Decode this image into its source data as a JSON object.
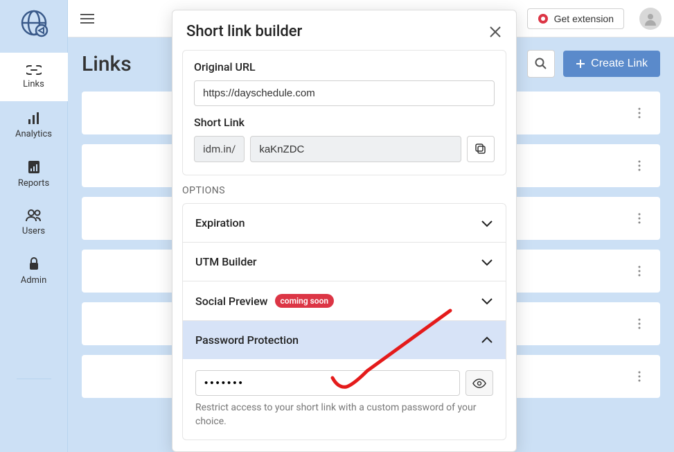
{
  "sidebar": {
    "items": [
      {
        "label": "Links"
      },
      {
        "label": "Analytics"
      },
      {
        "label": "Reports"
      },
      {
        "label": "Users"
      },
      {
        "label": "Admin"
      }
    ]
  },
  "topbar": {
    "get_extension": "Get extension"
  },
  "page": {
    "title": "Links",
    "create_link": "Create Link"
  },
  "modal": {
    "title": "Short link builder",
    "original_url_label": "Original URL",
    "original_url_value": "https://dayschedule.com",
    "short_link_label": "Short Link",
    "domain_prefix": "idm.in/",
    "slug_value": "kaKnZDC",
    "options_label": "OPTIONS",
    "accordion": {
      "expiration": "Expiration",
      "utm": "UTM Builder",
      "social": "Social Preview",
      "coming_soon": "coming soon",
      "password": "Password Protection",
      "password_value": "•••••••",
      "password_help": "Restrict access to your short link with a custom password of your choice."
    }
  }
}
